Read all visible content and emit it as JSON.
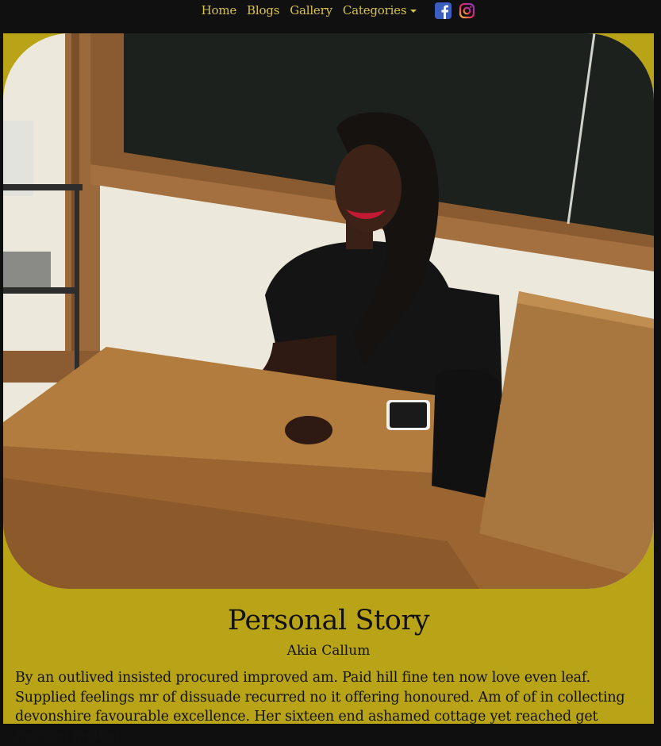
{
  "nav": {
    "items": [
      {
        "label": "Home"
      },
      {
        "label": "Blogs"
      },
      {
        "label": "Gallery"
      },
      {
        "label": "Categories"
      }
    ],
    "social": [
      {
        "icon": "facebook-icon"
      },
      {
        "icon": "instagram-icon"
      }
    ]
  },
  "post": {
    "title": "Personal Story",
    "author": "Akia Callum",
    "body": "By an outlived insisted procured improved am. Paid hill fine ten now love even leaf. Supplied feelings mr of dissuade recurred no it offering honoured. Am of of in collecting devonshire favourable excellence. Her sixteen end ashamed cottage yet reached get hearing invited."
  },
  "colors": {
    "nav_bg": "#101010",
    "nav_link": "#d8c24a",
    "card_bg": "#b8a416",
    "facebook": "#3b5ec0"
  }
}
